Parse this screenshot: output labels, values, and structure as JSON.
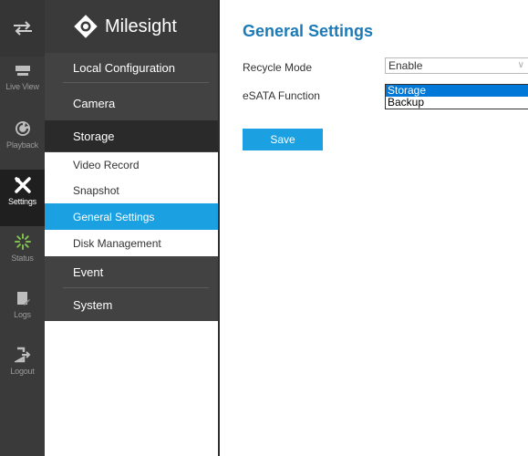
{
  "rail": {
    "items": [
      {
        "label": "Live View",
        "icon": "monitor-icon"
      },
      {
        "label": "Playback",
        "icon": "playback-icon"
      },
      {
        "label": "Settings",
        "icon": "tools-icon"
      },
      {
        "label": "Status",
        "icon": "status-icon"
      },
      {
        "label": "Logs",
        "icon": "logs-icon"
      },
      {
        "label": "Logout",
        "icon": "logout-icon"
      }
    ]
  },
  "menu": {
    "brand": "Milesight",
    "local_configuration": "Local Configuration",
    "camera": "Camera",
    "storage": "Storage",
    "storage_items": [
      "Video Record",
      "Snapshot",
      "General Settings",
      "Disk Management"
    ],
    "event": "Event",
    "system": "System"
  },
  "content": {
    "title": "General Settings",
    "recycle_mode_label": "Recycle Mode",
    "recycle_mode_value": "Enable",
    "esata_label": "eSATA Function",
    "esata_options": [
      "Storage",
      "Backup"
    ],
    "save_label": "Save"
  },
  "colors": {
    "accent": "#1ba1e2",
    "title": "#1c7ab7",
    "rail_bg": "#3a3a3a",
    "dropdown_selected": "#0078d7"
  }
}
